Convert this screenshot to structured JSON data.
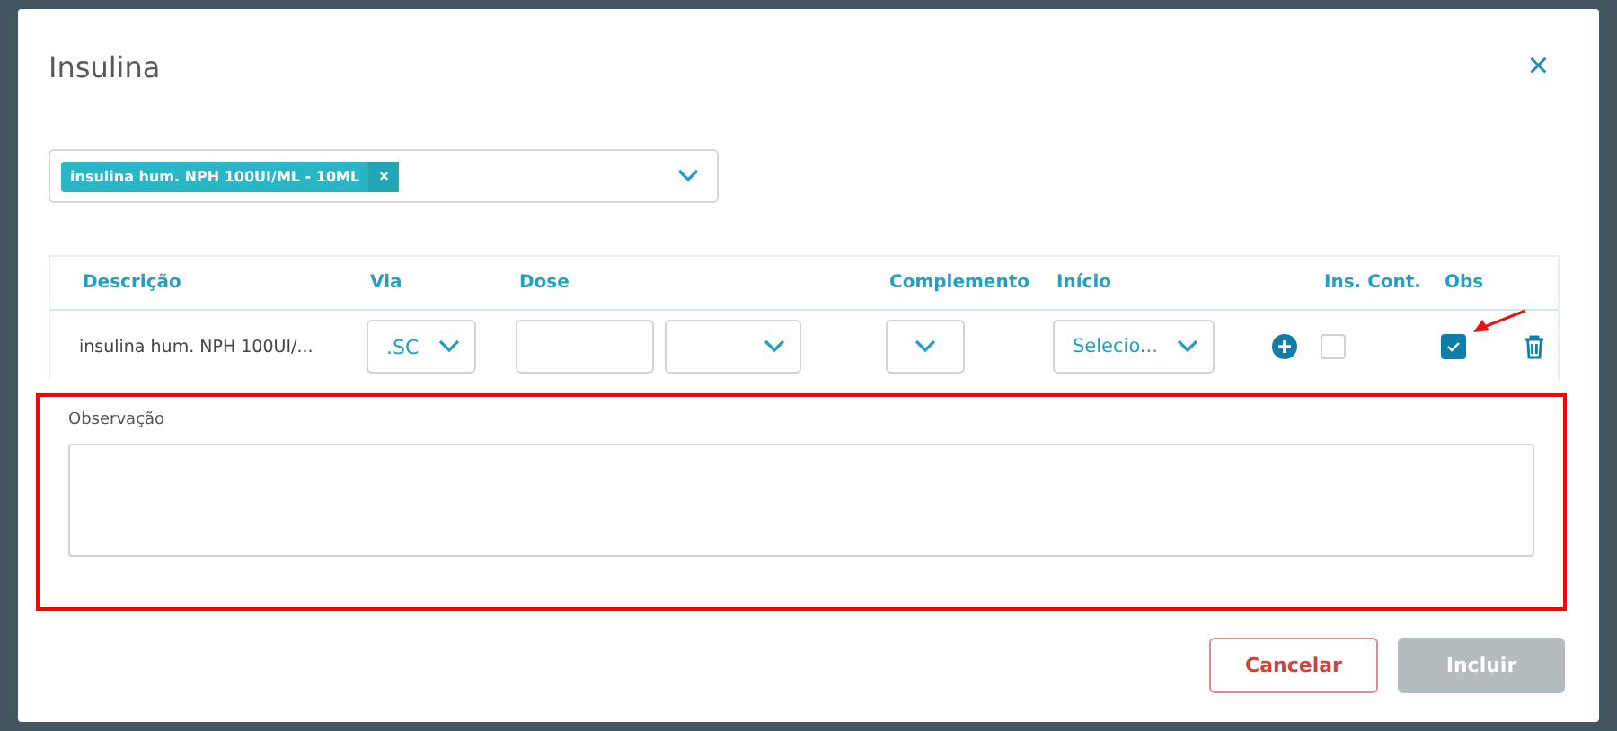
{
  "dialog": {
    "title": "Insulina",
    "close": "×"
  },
  "medication_select": {
    "chips": [
      {
        "label": "insulina hum. NPH 100UI/ML - 10ML",
        "remove": "×"
      }
    ]
  },
  "table": {
    "columns": [
      "Descrição",
      "Via",
      "Dose",
      "Complemento",
      "Início",
      "Ins. Cont.",
      "Obs"
    ],
    "rows": [
      {
        "description": "insulina hum. NPH 100UI/...",
        "via": ".SC",
        "dose": "",
        "start_placeholder": "Selecio...",
        "ins_cont_checked": false,
        "obs_checked": true
      }
    ]
  },
  "observation": {
    "label": "Observação",
    "highlighted": true
  },
  "buttons": [
    {
      "label": "Cancelar",
      "kind": "outline",
      "disabled": false
    },
    {
      "label": "Incluir",
      "kind": "primary",
      "disabled": true
    }
  ]
}
